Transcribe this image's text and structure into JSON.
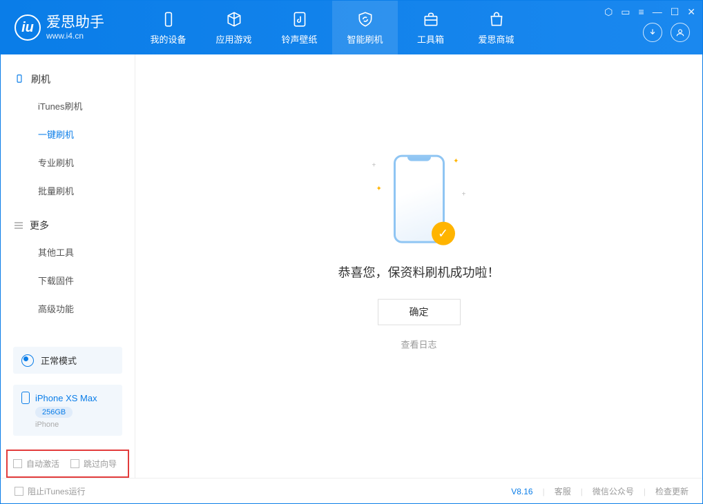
{
  "app": {
    "name_cn": "爱思助手",
    "name_en": "www.i4.cn"
  },
  "tabs": [
    {
      "label": "我的设备"
    },
    {
      "label": "应用游戏"
    },
    {
      "label": "铃声壁纸"
    },
    {
      "label": "智能刷机"
    },
    {
      "label": "工具箱"
    },
    {
      "label": "爱思商城"
    }
  ],
  "sidebar": {
    "section1": {
      "title": "刷机",
      "items": [
        "iTunes刷机",
        "一键刷机",
        "专业刷机",
        "批量刷机"
      ]
    },
    "section2": {
      "title": "更多",
      "items": [
        "其他工具",
        "下载固件",
        "高级功能"
      ]
    }
  },
  "mode": {
    "label": "正常模式"
  },
  "device": {
    "name": "iPhone XS Max",
    "capacity": "256GB",
    "type": "iPhone"
  },
  "options": {
    "auto_activate": "自动激活",
    "skip_guide": "跳过向导"
  },
  "result": {
    "title": "恭喜您，保资料刷机成功啦！",
    "ok": "确定",
    "log": "查看日志"
  },
  "footer": {
    "block_itunes": "阻止iTunes运行",
    "version": "V8.16",
    "support": "客服",
    "wechat": "微信公众号",
    "update": "检查更新"
  }
}
